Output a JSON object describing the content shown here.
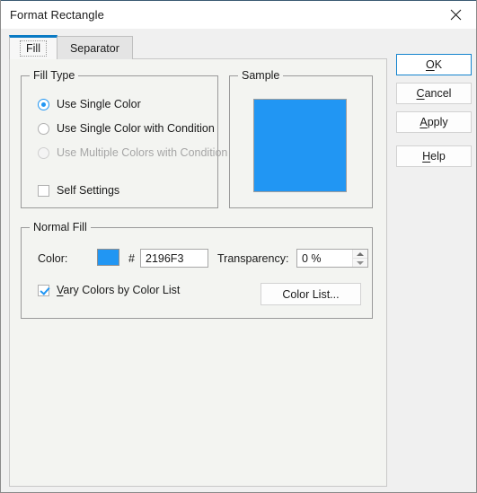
{
  "window": {
    "title": "Format Rectangle",
    "close_icon": "close-icon"
  },
  "tabs": [
    {
      "label": "Fill",
      "active": true
    },
    {
      "label": "Separator",
      "active": false
    }
  ],
  "fill_type": {
    "group_title": "Fill Type",
    "options": [
      {
        "label": "Use Single Color",
        "selected": true,
        "disabled": false
      },
      {
        "label": "Use Single Color with Condition",
        "selected": false,
        "disabled": false
      },
      {
        "label": "Use Multiple Colors with Condition",
        "selected": false,
        "disabled": true
      }
    ],
    "self_settings": {
      "label": "Self Settings",
      "checked": false
    }
  },
  "sample": {
    "group_title": "Sample",
    "swatch_color": "#2196F3"
  },
  "normal_fill": {
    "group_title": "Normal Fill",
    "color_label": "Color:",
    "color_value": "#2196F3",
    "hash": "#",
    "hex_value": "2196F3",
    "transparency_label": "Transparency:",
    "transparency_value": "0 %",
    "vary_colors": {
      "label": "Vary Colors by Color List",
      "accel": "V",
      "rest": "ary Colors by Color List",
      "checked": true
    },
    "color_list_button": {
      "label": "Color List..."
    }
  },
  "buttons": {
    "ok": {
      "accel": "O",
      "rest": "K",
      "prefix": ""
    },
    "cancel": {
      "accel": "C",
      "rest": "ancel",
      "prefix": ""
    },
    "apply": {
      "accel": "A",
      "rest": "pply",
      "prefix": ""
    },
    "help": {
      "accel": "H",
      "rest": "elp",
      "prefix": ""
    }
  }
}
